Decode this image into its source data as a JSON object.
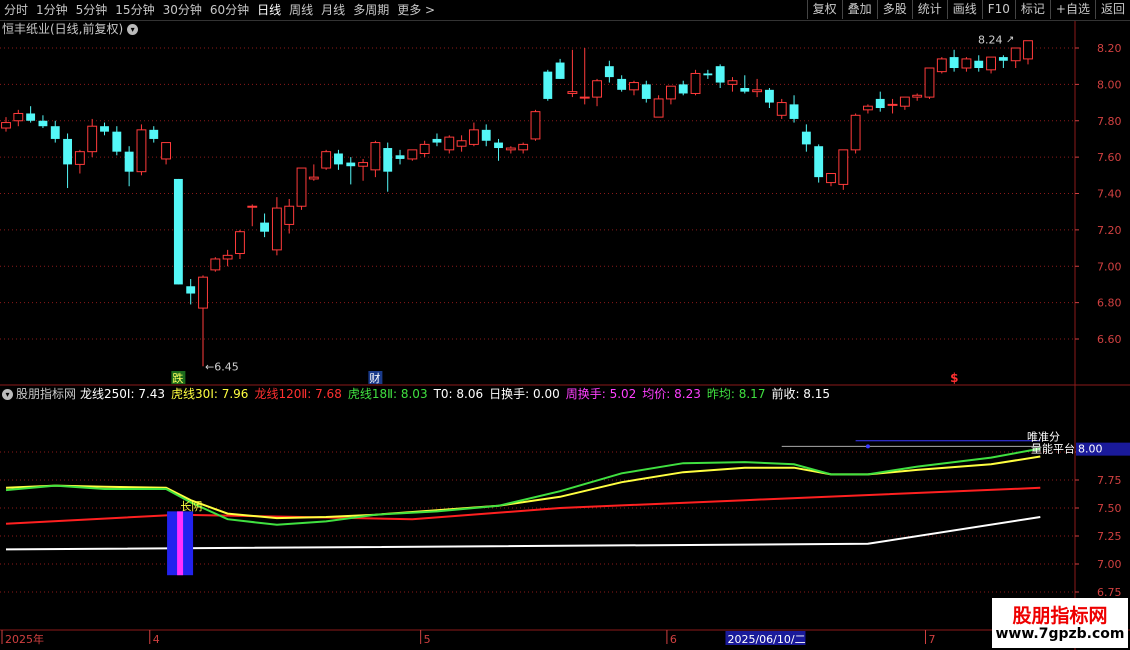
{
  "toolbar": {
    "periods": [
      {
        "label": "分时",
        "active": false
      },
      {
        "label": "1分钟",
        "active": false
      },
      {
        "label": "5分钟",
        "active": false
      },
      {
        "label": "15分钟",
        "active": false
      },
      {
        "label": "30分钟",
        "active": false
      },
      {
        "label": "60分钟",
        "active": false
      },
      {
        "label": "日线",
        "active": true
      },
      {
        "label": "周线",
        "active": false
      },
      {
        "label": "月线",
        "active": false
      },
      {
        "label": "多周期",
        "active": false
      },
      {
        "label": "更多 >",
        "active": false
      }
    ],
    "actions": [
      "复权",
      "叠加",
      "多股",
      "统计",
      "画线",
      "F10",
      "标记",
      "+自选",
      "返回"
    ]
  },
  "stock": {
    "title": "恒丰纸业(日线,前复权)",
    "dropdown_icon": "chevron-down-icon"
  },
  "price_axis": {
    "labels": [
      "8.20",
      "8.00",
      "7.80",
      "7.60",
      "7.40",
      "7.20",
      "7.00",
      "6.80",
      "6.60"
    ],
    "values": [
      8.2,
      8.0,
      7.8,
      7.6,
      7.4,
      7.2,
      7.0,
      6.8,
      6.6
    ]
  },
  "price_annotations": {
    "low_label": "←6.45",
    "high_label": "8.24",
    "high_arrow": "↗",
    "event_die": "跌",
    "event_cai": "财",
    "event_money": "$"
  },
  "candles": [
    [
      7.76,
      7.82,
      7.74,
      7.79
    ],
    [
      7.8,
      7.86,
      7.77,
      7.84
    ],
    [
      7.84,
      7.88,
      7.79,
      7.8
    ],
    [
      7.8,
      7.83,
      7.76,
      7.77
    ],
    [
      7.77,
      7.8,
      7.68,
      7.7
    ],
    [
      7.7,
      7.73,
      7.43,
      7.56
    ],
    [
      7.56,
      7.64,
      7.51,
      7.63
    ],
    [
      7.63,
      7.81,
      7.6,
      7.77
    ],
    [
      7.77,
      7.79,
      7.72,
      7.74
    ],
    [
      7.74,
      7.77,
      7.61,
      7.63
    ],
    [
      7.63,
      7.66,
      7.44,
      7.52
    ],
    [
      7.52,
      7.78,
      7.5,
      7.75
    ],
    [
      7.75,
      7.77,
      7.68,
      7.7
    ],
    [
      7.59,
      7.68,
      7.56,
      7.68
    ],
    [
      7.48,
      7.48,
      6.9,
      6.9
    ],
    [
      6.89,
      6.93,
      6.79,
      6.85
    ],
    [
      6.77,
      6.95,
      6.45,
      6.94
    ],
    [
      6.98,
      7.05,
      6.97,
      7.04
    ],
    [
      7.04,
      7.09,
      7.0,
      7.06
    ],
    [
      7.07,
      7.2,
      7.04,
      7.19
    ],
    [
      7.33,
      7.34,
      7.22,
      7.33
    ],
    [
      7.24,
      7.29,
      7.16,
      7.19
    ],
    [
      7.09,
      7.38,
      7.06,
      7.32
    ],
    [
      7.23,
      7.37,
      7.18,
      7.33
    ],
    [
      7.33,
      7.54,
      7.31,
      7.54
    ],
    [
      7.48,
      7.56,
      7.47,
      7.49
    ],
    [
      7.54,
      7.64,
      7.53,
      7.63
    ],
    [
      7.62,
      7.64,
      7.53,
      7.56
    ],
    [
      7.57,
      7.6,
      7.45,
      7.55
    ],
    [
      7.55,
      7.59,
      7.47,
      7.57
    ],
    [
      7.53,
      7.69,
      7.49,
      7.68
    ],
    [
      7.65,
      7.68,
      7.41,
      7.52
    ],
    [
      7.61,
      7.64,
      7.56,
      7.59
    ],
    [
      7.59,
      7.64,
      7.58,
      7.64
    ],
    [
      7.62,
      7.69,
      7.6,
      7.67
    ],
    [
      7.7,
      7.73,
      7.66,
      7.68
    ],
    [
      7.64,
      7.72,
      7.62,
      7.71
    ],
    [
      7.66,
      7.72,
      7.63,
      7.69
    ],
    [
      7.67,
      7.79,
      7.66,
      7.75
    ],
    [
      7.75,
      7.78,
      7.66,
      7.69
    ],
    [
      7.68,
      7.7,
      7.58,
      7.65
    ],
    [
      7.64,
      7.66,
      7.62,
      7.65
    ],
    [
      7.64,
      7.68,
      7.62,
      7.67
    ],
    [
      7.7,
      7.86,
      7.69,
      7.85
    ],
    [
      8.07,
      8.08,
      7.91,
      7.92
    ],
    [
      8.12,
      8.14,
      8.03,
      8.03
    ],
    [
      7.95,
      8.19,
      7.93,
      7.96
    ],
    [
      7.93,
      8.2,
      7.89,
      7.93
    ],
    [
      7.93,
      8.03,
      7.88,
      8.02
    ],
    [
      8.1,
      8.13,
      8.01,
      8.04
    ],
    [
      8.03,
      8.05,
      7.96,
      7.97
    ],
    [
      7.97,
      8.02,
      7.94,
      8.01
    ],
    [
      8.0,
      8.02,
      7.9,
      7.92
    ],
    [
      7.82,
      7.94,
      7.82,
      7.92
    ],
    [
      7.92,
      7.99,
      7.89,
      7.99
    ],
    [
      8.0,
      8.02,
      7.94,
      7.95
    ],
    [
      7.95,
      8.08,
      7.94,
      8.06
    ],
    [
      8.06,
      8.08,
      8.03,
      8.05
    ],
    [
      8.1,
      8.11,
      7.98,
      8.01
    ],
    [
      8.0,
      8.04,
      7.96,
      8.02
    ],
    [
      7.98,
      8.05,
      7.95,
      7.96
    ],
    [
      7.96,
      8.03,
      7.93,
      7.97
    ],
    [
      7.97,
      7.98,
      7.87,
      7.9
    ],
    [
      7.83,
      7.92,
      7.81,
      7.9
    ],
    [
      7.89,
      7.94,
      7.79,
      7.81
    ],
    [
      7.74,
      7.78,
      7.63,
      7.67
    ],
    [
      7.66,
      7.67,
      7.46,
      7.49
    ],
    [
      7.46,
      7.51,
      7.44,
      7.51
    ],
    [
      7.45,
      7.63,
      7.42,
      7.64
    ],
    [
      7.64,
      7.84,
      7.62,
      7.83
    ],
    [
      7.86,
      7.89,
      7.84,
      7.88
    ],
    [
      7.92,
      7.96,
      7.85,
      7.87
    ],
    [
      7.89,
      7.92,
      7.84,
      7.89
    ],
    [
      7.88,
      7.93,
      7.86,
      7.93
    ],
    [
      7.93,
      7.95,
      7.91,
      7.94
    ],
    [
      7.93,
      8.09,
      7.92,
      8.09
    ],
    [
      8.07,
      8.15,
      8.06,
      8.14
    ],
    [
      8.15,
      8.19,
      8.07,
      8.09
    ],
    [
      8.09,
      8.15,
      8.07,
      8.14
    ],
    [
      8.13,
      8.16,
      8.07,
      8.09
    ],
    [
      8.08,
      8.15,
      8.06,
      8.15
    ],
    [
      8.15,
      8.16,
      8.09,
      8.13
    ],
    [
      8.13,
      8.2,
      8.09,
      8.2
    ],
    [
      8.14,
      8.24,
      8.11,
      8.24
    ]
  ],
  "indicator": {
    "name": "股朋指标网",
    "items": [
      {
        "label": "龙线250Ⅰ: 7.43",
        "color": "#ffffff"
      },
      {
        "label": "虎线30Ⅰ: 7.96",
        "color": "#ffff40"
      },
      {
        "label": "龙线120Ⅱ: 7.68",
        "color": "#ff3030"
      },
      {
        "label": "虎线18Ⅱ: 8.03",
        "color": "#40e040"
      },
      {
        "label": "T0: 8.06",
        "color": "#ffffff"
      },
      {
        "label": "日换手: 0.00",
        "color": "#ffffff"
      },
      {
        "label": "周换手: 5.02",
        "color": "#ff40ff"
      },
      {
        "label": "均价: 8.23",
        "color": "#ff40ff"
      },
      {
        "label": "昨均: 8.17",
        "color": "#40e040"
      },
      {
        "label": "前收: 8.15",
        "color": "#ffffff"
      }
    ],
    "axis_labels": [
      "8.00",
      "7.75",
      "7.50",
      "7.25",
      "7.00",
      "6.75"
    ],
    "axis_values": [
      8.0,
      7.75,
      7.5,
      7.25,
      7.0,
      6.75
    ],
    "current_value_label": "8.00",
    "text_changyin": "长阴",
    "text_liangneng": "量能平台",
    "text_overlap": "唯准分",
    "lines": {
      "dragon250": {
        "color": "#ffffff",
        "points": [
          [
            0,
            7.13
          ],
          [
            70,
            7.18
          ],
          [
            84,
            7.42
          ]
        ]
      },
      "dragon120": {
        "color": "#ff2020",
        "points": [
          [
            0,
            7.36
          ],
          [
            14,
            7.44
          ],
          [
            24,
            7.42
          ],
          [
            33,
            7.4
          ],
          [
            45,
            7.5
          ],
          [
            60,
            7.57
          ],
          [
            84,
            7.68
          ]
        ]
      },
      "tiger30": {
        "color": "#ffff40",
        "points": [
          [
            0,
            7.68
          ],
          [
            4,
            7.7
          ],
          [
            8,
            7.69
          ],
          [
            13,
            7.68
          ],
          [
            15,
            7.57
          ],
          [
            18,
            7.45
          ],
          [
            22,
            7.41
          ],
          [
            26,
            7.42
          ],
          [
            30,
            7.44
          ],
          [
            35,
            7.48
          ],
          [
            40,
            7.52
          ],
          [
            45,
            7.6
          ],
          [
            50,
            7.73
          ],
          [
            55,
            7.82
          ],
          [
            60,
            7.86
          ],
          [
            64,
            7.86
          ],
          [
            67,
            7.8
          ],
          [
            70,
            7.8
          ],
          [
            74,
            7.84
          ],
          [
            80,
            7.89
          ],
          [
            84,
            7.96
          ]
        ]
      },
      "tiger18": {
        "color": "#40e040",
        "points": [
          [
            0,
            7.66
          ],
          [
            4,
            7.7
          ],
          [
            8,
            7.67
          ],
          [
            13,
            7.67
          ],
          [
            15,
            7.55
          ],
          [
            18,
            7.4
          ],
          [
            22,
            7.35
          ],
          [
            26,
            7.38
          ],
          [
            30,
            7.44
          ],
          [
            35,
            7.47
          ],
          [
            40,
            7.52
          ],
          [
            45,
            7.65
          ],
          [
            50,
            7.81
          ],
          [
            55,
            7.9
          ],
          [
            60,
            7.91
          ],
          [
            64,
            7.89
          ],
          [
            67,
            7.8
          ],
          [
            70,
            7.8
          ],
          [
            74,
            7.87
          ],
          [
            80,
            7.95
          ],
          [
            84,
            8.03
          ]
        ]
      }
    }
  },
  "date_axis": {
    "labels": [
      {
        "text": "2025年",
        "idx": 0
      },
      {
        "text": "4",
        "idx": 12
      },
      {
        "text": "5",
        "idx": 34
      },
      {
        "text": "6",
        "idx": 54
      },
      {
        "text": "7",
        "idx": 75
      }
    ],
    "highlight": {
      "text": "2025/06/10/二",
      "idx": 59
    }
  },
  "watermark": {
    "line1": "股朋指标网",
    "line2": "www.7gpzb.com"
  },
  "colors": {
    "up": "#ff3b3b",
    "down": "#54f7f7",
    "grid": "#8b1a1a",
    "axis_text": "#d04040",
    "highlight_bg": "#1a1a9a"
  }
}
